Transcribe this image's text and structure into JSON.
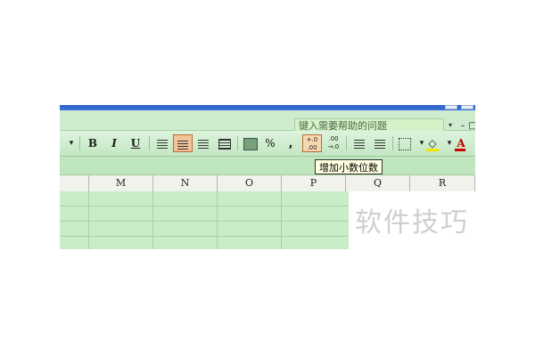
{
  "help": {
    "placeholder": "键入需要帮助的问题"
  },
  "toolbar": {
    "bold": "B",
    "italic": "I",
    "underline": "U",
    "percent": "%",
    "comma": ",",
    "increase_decimal_top": "+.0",
    "increase_decimal_bottom": ".00",
    "decrease_decimal_top": ".00",
    "decrease_decimal_bottom": "→.0",
    "font_color": "A",
    "dropdown": "▾"
  },
  "tooltip": {
    "text": "增加小数位数"
  },
  "columns": [
    "M",
    "N",
    "O",
    "P",
    "Q",
    "R"
  ],
  "watermark": "软件技巧",
  "colors": {
    "accent_active": "#f3c39a",
    "sheet_green": "#c9ecc9",
    "title_blue": "#2e63c8",
    "font_red": "#c00000"
  }
}
